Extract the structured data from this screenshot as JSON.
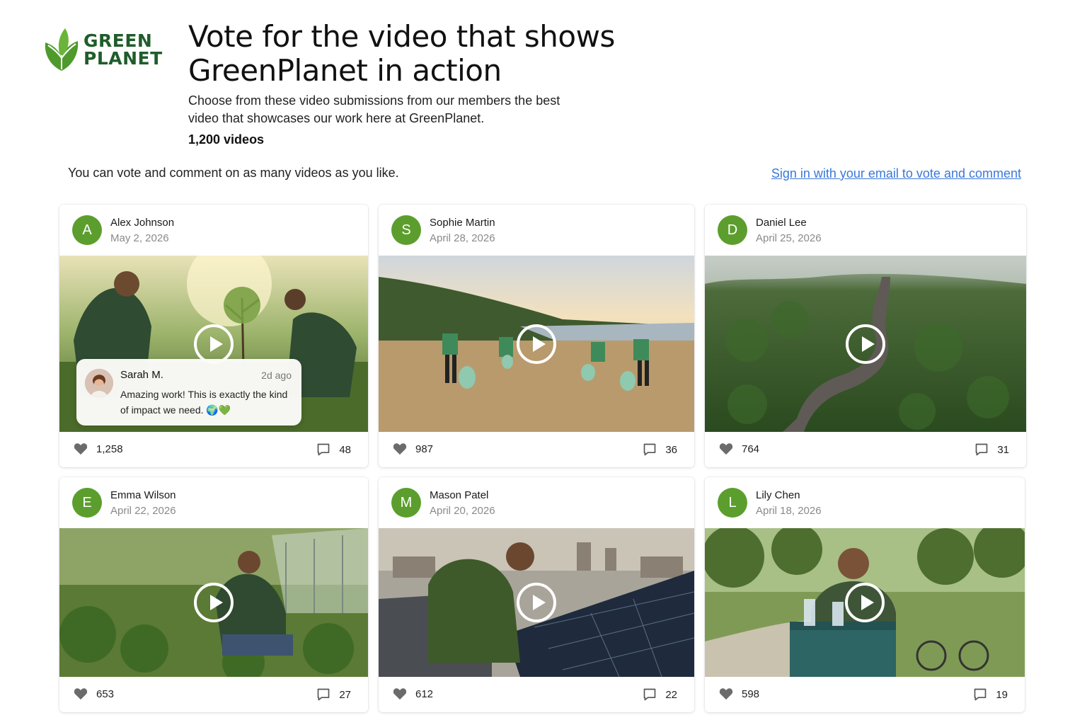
{
  "brand": {
    "line1": "GREEN",
    "line2": "PLANET",
    "color": "#1f5d2b"
  },
  "header": {
    "title": "Vote for the video that shows GreenPlanet in action",
    "subtitle": "Choose from these video submissions from our members the best video that showcases our work here at GreenPlanet.",
    "count": "1,200 videos"
  },
  "note": "You can vote and comment on as many videos as you like.",
  "signin_link": "Sign in with your email to vote and comment",
  "colors": {
    "accent": "#5c9e2e",
    "link": "#3b78d8"
  },
  "videos": [
    {
      "initial": "A",
      "author": "Alex Johnson",
      "date": "May 2, 2026",
      "likes": "1,258",
      "comments": "48"
    },
    {
      "initial": "S",
      "author": "Sophie Martin",
      "date": "April 28, 2026",
      "likes": "987",
      "comments": "36"
    },
    {
      "initial": "D",
      "author": "Daniel Lee",
      "date": "April 25, 2026",
      "likes": "764",
      "comments": "31"
    },
    {
      "initial": "E",
      "author": "Emma Wilson",
      "date": "April 22, 2026",
      "likes": "653",
      "comments": "27"
    },
    {
      "initial": "M",
      "author": "Mason Patel",
      "date": "April 20, 2026",
      "likes": "612",
      "comments": "22"
    },
    {
      "initial": "L",
      "author": "Lily Chen",
      "date": "April 18, 2026",
      "likes": "598",
      "comments": "19"
    }
  ],
  "featured_comment": {
    "author": "Sarah M.",
    "time": "2d ago",
    "text": "Amazing work! This is exactly the kind of impact we need. 🌍💚"
  },
  "icons": {
    "like": "heart-icon",
    "comment": "comment-icon",
    "play": "play-icon"
  }
}
